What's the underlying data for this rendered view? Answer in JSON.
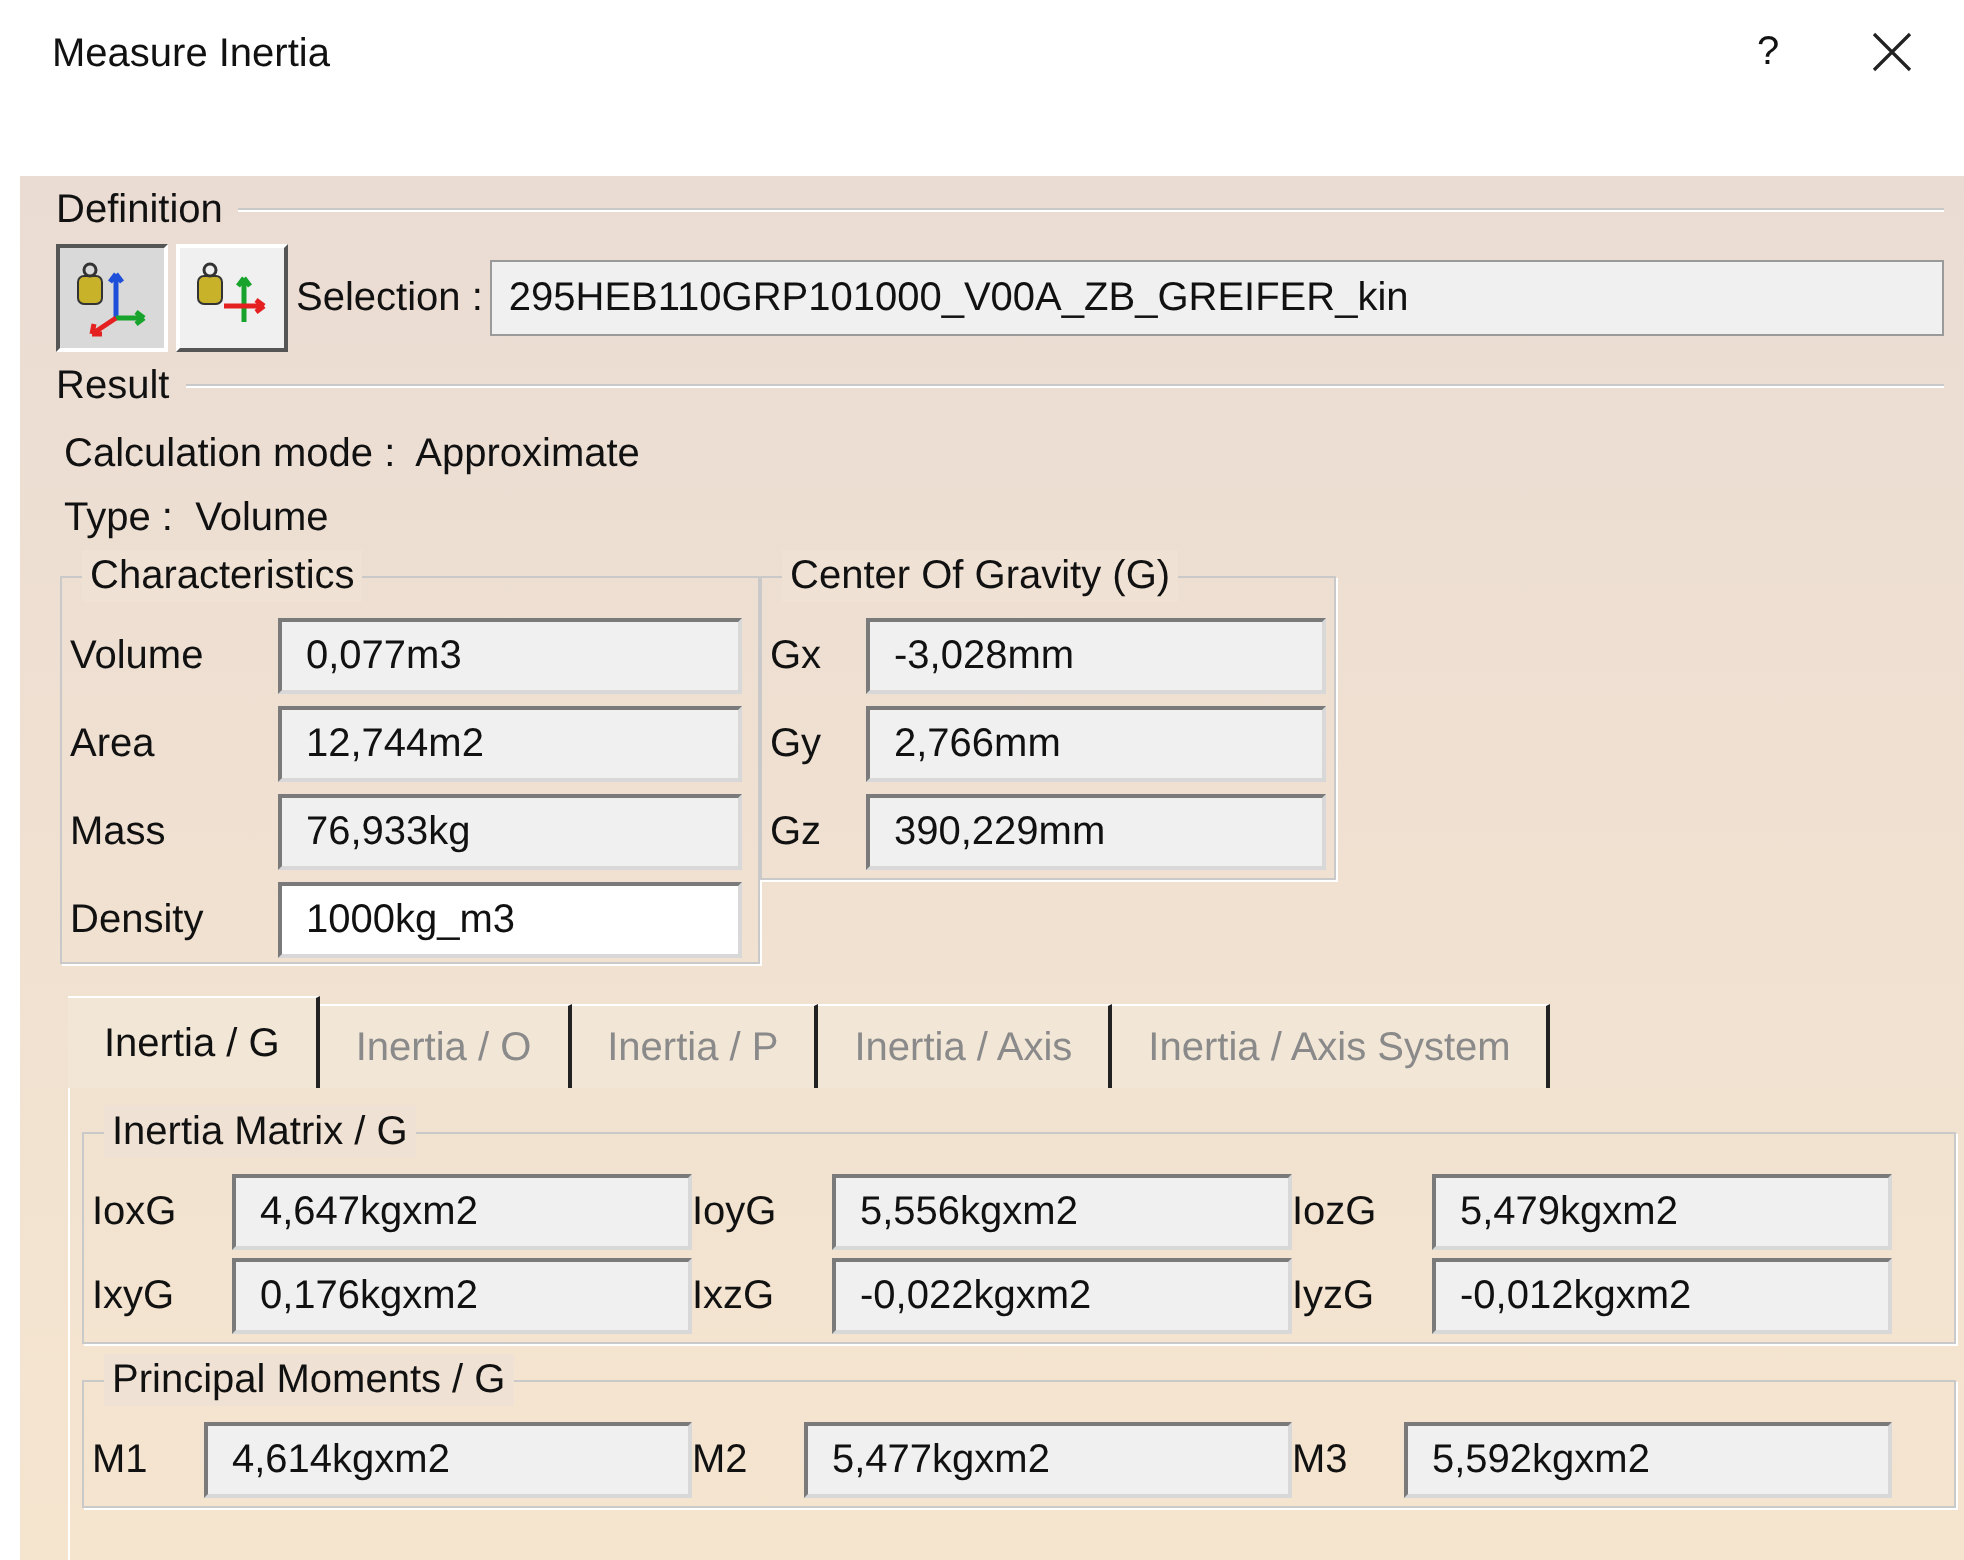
{
  "window": {
    "title": "Measure Inertia",
    "help": "?"
  },
  "definition": {
    "title": "Definition",
    "modes": [
      {
        "kind": "axes-xyz",
        "selected": true
      },
      {
        "kind": "axes-xy",
        "selected": false
      }
    ],
    "selection_label": "Selection :",
    "selection_value": "295HEB110GRP101000_V00A_ZB_GREIFER_kin"
  },
  "result": {
    "title": "Result",
    "calculation_mode": "Calculation mode :  Approximate",
    "type": "Type :  Volume"
  },
  "characteristics": {
    "title": "Characteristics",
    "rows": [
      {
        "label": "Volume",
        "value": "0,077m3",
        "editable": false
      },
      {
        "label": "Area",
        "value": "12,744m2",
        "editable": false
      },
      {
        "label": "Mass",
        "value": "76,933kg",
        "editable": false
      },
      {
        "label": "Density",
        "value": "1000kg_m3",
        "editable": true
      }
    ]
  },
  "center_of_gravity": {
    "title": "Center Of Gravity (G)",
    "rows": [
      {
        "label": "Gx",
        "value": "-3,028mm"
      },
      {
        "label": "Gy",
        "value": "2,766mm"
      },
      {
        "label": "Gz",
        "value": "390,229mm"
      }
    ]
  },
  "tabs": [
    {
      "label": "Inertia / G",
      "selected": true
    },
    {
      "label": "Inertia / O",
      "selected": false
    },
    {
      "label": "Inertia / P",
      "selected": false
    },
    {
      "label": "Inertia / Axis",
      "selected": false
    },
    {
      "label": "Inertia / Axis System",
      "selected": false
    }
  ],
  "inertia_matrix": {
    "title": "Inertia Matrix / G",
    "rows": [
      [
        {
          "label": "IoxG",
          "value": "4,647kgxm2"
        },
        {
          "label": "IoyG",
          "value": "5,556kgxm2"
        },
        {
          "label": "IozG",
          "value": "5,479kgxm2"
        }
      ],
      [
        {
          "label": "IxyG",
          "value": "0,176kgxm2"
        },
        {
          "label": "IxzG",
          "value": "-0,022kgxm2"
        },
        {
          "label": "IyzG",
          "value": "-0,012kgxm2"
        }
      ]
    ]
  },
  "principal_moments": {
    "title": "Principal Moments / G",
    "cells": [
      {
        "label": "M1",
        "value": "4,614kgxm2"
      },
      {
        "label": "M2",
        "value": "5,477kgxm2"
      },
      {
        "label": "M3",
        "value": "5,592kgxm2"
      }
    ]
  }
}
